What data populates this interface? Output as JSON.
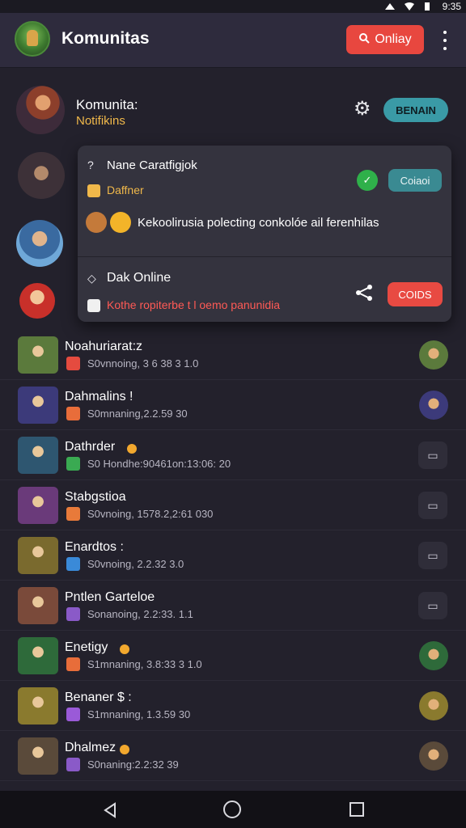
{
  "status_bar": {
    "time": "9:35"
  },
  "app_bar": {
    "title": "Komunitas",
    "online_button": "Onliay",
    "online_icon": "search-icon",
    "menu_icon": "kebab-icon"
  },
  "header": {
    "name": "Komunita:",
    "subtitle": "Notifikins",
    "gear_icon": "gear-icon",
    "tag_button": "BENAIN"
  },
  "popup": {
    "title1": "Nane Caratfigjok",
    "sub1": "Daffner",
    "button1": "Coiaoi",
    "message": "Kekoolirusia polecting conkolóe ail ferenhilas",
    "title2": "Dak Online",
    "sub2": "Kothe ropiterbe t l oemo panunidia",
    "button2": "COIDS"
  },
  "list": [
    {
      "name": "Noahuriarat:z",
      "status": "S0vnnoing, 3 6 38 3 1.0",
      "thumb": "#5b7a3c",
      "mini": "#e54b3f",
      "right": "avatar"
    },
    {
      "name": "Dahmalins !",
      "status": "S0mnaning,2.2.59 30",
      "thumb": "#3c3a7a",
      "mini": "#e86d3a",
      "right": "avatar"
    },
    {
      "name": "Dathrder",
      "status": "S0 Hondhe:90461on:13:06: 20",
      "thumb": "#2e5670",
      "mini": "#3aaa52",
      "right": "box",
      "badge": true
    },
    {
      "name": "Stabgstioa",
      "status": "S0vnoing, 1578.2,2:61 030",
      "thumb": "#6a3a7a",
      "mini": "#e87a3a",
      "right": "box"
    },
    {
      "name": "Enardtos :",
      "status": "S0vnoing, 2.2.32 3.0",
      "thumb": "#7a6a2e",
      "mini": "#3a8ad8",
      "right": "box"
    },
    {
      "name": "Pntlen Garteloe",
      "status": "Sonanoing, 2.2:33. 1.1",
      "thumb": "#7a4a3a",
      "mini": "#8a5ac8",
      "right": "box"
    },
    {
      "name": "Enetigy",
      "status": "S1mnaning, 3.8:33 3 1.0",
      "thumb": "#2e6a3a",
      "mini": "#e86d3a",
      "right": "avatar",
      "badge": true
    },
    {
      "name": "Benaner $ :",
      "status": "S1mnaning, 1.3.59 30",
      "thumb": "#8a7a2e",
      "mini": "#9a5ad8",
      "right": "avatar"
    },
    {
      "name": "Dhalmez",
      "status": "S0naning:2.2:32 39",
      "thumb": "#5a4a3a",
      "mini": "#8a5ac8",
      "right": "avatar",
      "badge": true
    }
  ]
}
